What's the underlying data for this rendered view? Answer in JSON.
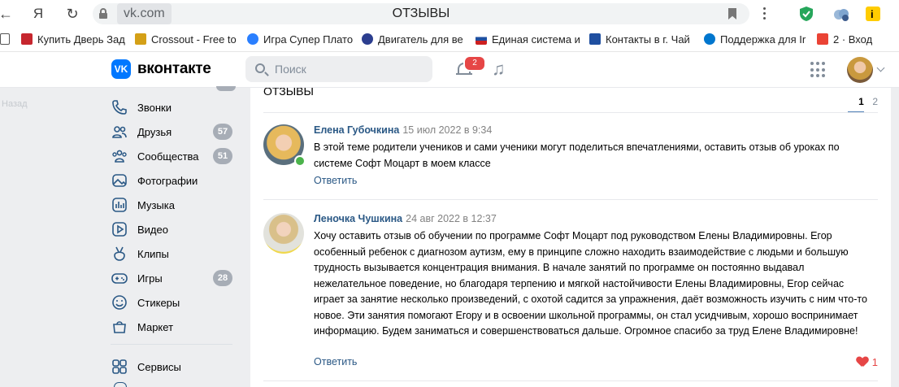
{
  "browser": {
    "url_domain": "vk.com",
    "page_title": "ОТЗЫВЫ"
  },
  "bookmarks": [
    {
      "label": "Купить Дверь Зад",
      "icon": "door-shop-icon",
      "color": "#c6262e"
    },
    {
      "label": "Crossout - Free to",
      "icon": "crossout-icon",
      "color": "#d4a017"
    },
    {
      "label": "Игра Супер Плато",
      "icon": "game-icon",
      "color": "#2a7fff"
    },
    {
      "label": "Двигатель для ве",
      "icon": "engine-icon",
      "color": "#2c3e8f"
    },
    {
      "label": "Единая система и",
      "icon": "russia-flag-icon",
      "color": "#cc2020"
    },
    {
      "label": "Контакты в г. Чай",
      "icon": "contacts-icon",
      "color": "#1f4fa0"
    },
    {
      "label": "Поддержка для Ir",
      "icon": "dell-icon",
      "color": "#0076ce"
    },
    {
      "label": "2 · Вход",
      "icon": "mail-icon",
      "color": "#ea4335"
    }
  ],
  "vk": {
    "brand": "вконтакте",
    "logo_text": "VK",
    "search_placeholder": "Поиск",
    "notifications_count": "2",
    "accent": "#0077ff"
  },
  "back_link": "Назад",
  "sidebar": {
    "items": [
      {
        "label": "Звонки",
        "icon": "phone-icon",
        "count": ""
      },
      {
        "label": "Друзья",
        "icon": "friends-icon",
        "count": "57"
      },
      {
        "label": "Сообщества",
        "icon": "communities-icon",
        "count": "51"
      },
      {
        "label": "Фотографии",
        "icon": "photos-icon",
        "count": ""
      },
      {
        "label": "Музыка",
        "icon": "music-icon",
        "count": ""
      },
      {
        "label": "Видео",
        "icon": "video-icon",
        "count": ""
      },
      {
        "label": "Клипы",
        "icon": "clips-icon",
        "count": ""
      },
      {
        "label": "Игры",
        "icon": "games-icon",
        "count": "28"
      },
      {
        "label": "Стикеры",
        "icon": "stickers-icon",
        "count": ""
      },
      {
        "label": "Маркет",
        "icon": "market-icon",
        "count": ""
      },
      {
        "label": "Сервисы",
        "icon": "services-icon",
        "count": ""
      }
    ]
  },
  "topic": {
    "title": "ОТЗЫВЫ",
    "pages": [
      "1",
      "2"
    ],
    "active_page": "1"
  },
  "posts": [
    {
      "author": "Елена Губочкина",
      "date": "15 июл 2022 в 9:34",
      "text": "В этой теме родители учеников и сами ученики могут поделиться впечатлениями, оставить отзыв об уроках по системе Софт Моцарт в моем классе",
      "reply": "Ответить",
      "likes": ""
    },
    {
      "author": "Леночка Чушкина",
      "date": "24 авг 2022 в 12:37",
      "text": "Хочу оставить отзыв об обучении по программе Софт Моцарт под руководством Елены Владимировны. Егор особенный ребенок с диагнозом аутизм, ему в принципе сложно находить взаимодействие с людьми и большую трудность вызывается концентрация внимания. В начале занятий по программе он постоянно выдавал нежелательное поведение, но благодаря терпению и мягкой настойчивости Елены Владимировны, Егор сейчас играет за занятие несколько произведений, с охотой садится за упражнения, даёт возможность изучить с ним что-то новое. Эти занятия помогают Егору и в освоении школьной программы, он стал усидчивым, хорошо воспринимает информацию. Будем заниматься и совершенствоваться дальше. Огромное спасибо за труд Елене Владимировне!",
      "reply": "Ответить",
      "likes": "1"
    }
  ]
}
